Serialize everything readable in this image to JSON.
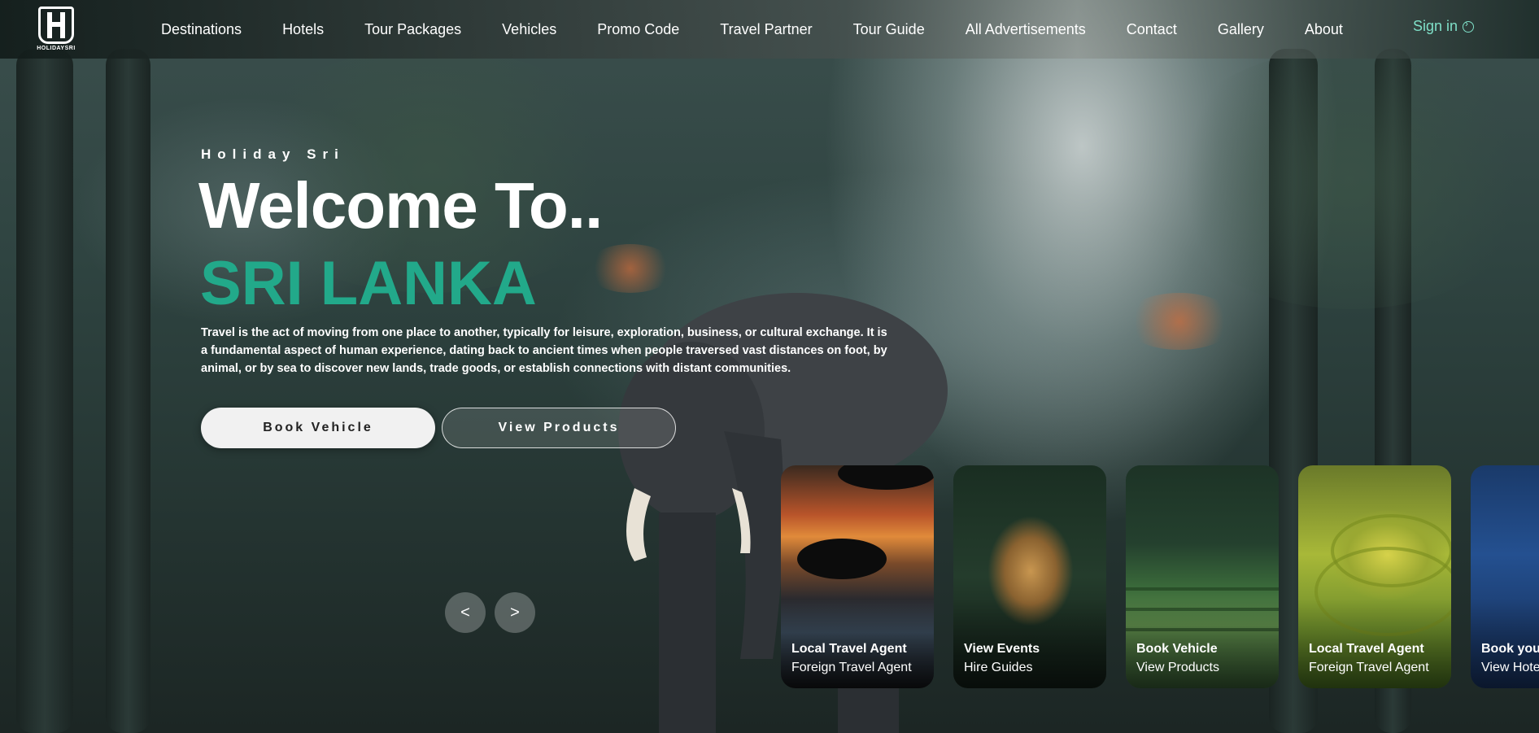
{
  "logo": {
    "text": "HOLIDAYSRI",
    "icon": "logo-icon"
  },
  "nav": {
    "items": [
      "Destinations",
      "Hotels",
      "Tour Packages",
      "Vehicles",
      "Promo Code",
      "Travel Partner",
      "Tour Guide",
      "All Advertisements",
      "Contact",
      "Gallery",
      "About"
    ],
    "sign_in": "Sign in",
    "sign_in_icon": "sign-in-icon",
    "sign_in_color": "#7fe0c8"
  },
  "hero": {
    "kicker": "Holiday Sri",
    "welcome": "Welcome To..",
    "country": "SRI LANKA",
    "country_color": "#22a98a",
    "description": "Travel is the act of moving from one place to another, typically for leisure, exploration, business, or cultural exchange. It is a fundamental aspect of human experience, dating back to ancient times when people traversed vast distances on foot, by animal, or by sea to discover new lands, trade goods, or establish connections with distant communities.",
    "primary_button": "Book Vehicle",
    "secondary_button": "View Products",
    "prev_arrow": "<",
    "next_arrow": ">"
  },
  "cards": [
    {
      "title": "Local Travel Agent",
      "subtitle": "Foreign Travel Agent"
    },
    {
      "title": "View Events",
      "subtitle": "Hire Guides"
    },
    {
      "title": "Book Vehicle",
      "subtitle": "View Products"
    },
    {
      "title": "Local Travel Agent",
      "subtitle": "Foreign Travel Agent"
    },
    {
      "title": "Book your",
      "subtitle": "View Hotels"
    }
  ]
}
